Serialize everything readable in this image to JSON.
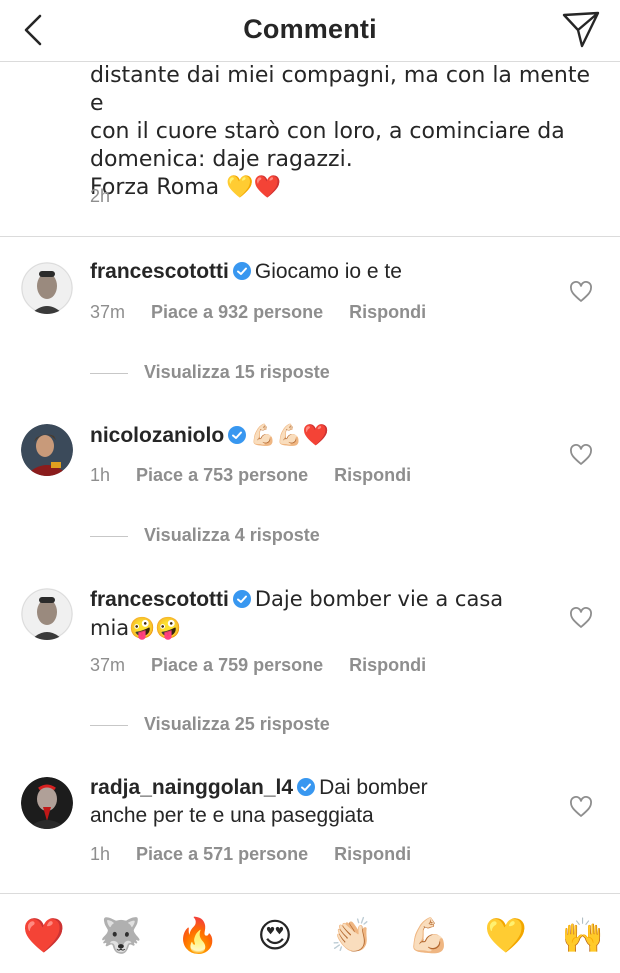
{
  "header": {
    "title": "Commenti"
  },
  "caption": {
    "text": "distante dai miei compagni, ma con la mente e\ncon il cuore starò con loro, a cominciare da\ndomenica: daje ragazzi.\nForza Roma 💛❤️",
    "time": "2h"
  },
  "comments": [
    {
      "username": "francescototti",
      "text": "Giocamo io e te",
      "time": "37m",
      "likes": "Piace a 932 persone",
      "reply": "Rispondi",
      "view_replies": "Visualizza 15 risposte"
    },
    {
      "username": "nicolozaniolo",
      "text": "💪🏻💪🏻❤️",
      "time": "1h",
      "likes": "Piace a 753 persone",
      "reply": "Rispondi",
      "view_replies": "Visualizza 4 risposte"
    },
    {
      "username": "francescototti",
      "text": "Daje bomber vie a casa mia🤪🤪",
      "time": "37m",
      "likes": "Piace a 759 persone",
      "reply": "Rispondi",
      "view_replies": "Visualizza 25 risposte"
    },
    {
      "username": "radja_nainggolan_l4",
      "text": "Dai bomber anche per te e una paseggiata",
      "time": "1h",
      "likes": "Piace a 571 persone",
      "reply": "Rispondi"
    }
  ],
  "quick_reactions": [
    "❤️",
    "🐺",
    "🔥",
    "😍",
    "👏🏻",
    "💪🏻",
    "💛",
    "🙌"
  ],
  "colors": {
    "text": "#262626",
    "muted": "#8e8e8e",
    "verified": "#3897f0",
    "divider": "#dbdbdb"
  }
}
